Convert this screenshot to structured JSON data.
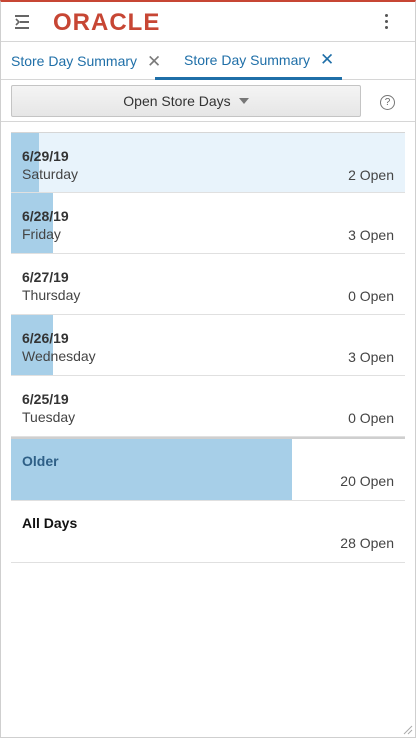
{
  "header": {
    "logo_text": "ORACLE",
    "brand_color": "#c74634"
  },
  "tabs": [
    {
      "label": "Store Day Summary",
      "active": false
    },
    {
      "label": "Store Day Summary",
      "active": true
    }
  ],
  "toolbar": {
    "dropdown_label": "Open Store Days",
    "help_label": "?"
  },
  "list": {
    "items": [
      {
        "date": "6/29/19",
        "day": "Saturday",
        "count": "2 Open",
        "open": 2,
        "selected": true
      },
      {
        "date": "6/28/19",
        "day": "Friday",
        "count": "3 Open",
        "open": 3,
        "selected": false
      },
      {
        "date": "6/27/19",
        "day": "Thursday",
        "count": "0 Open",
        "open": 0,
        "selected": false
      },
      {
        "date": "6/26/19",
        "day": "Wednesday",
        "count": "3 Open",
        "open": 3,
        "selected": false
      },
      {
        "date": "6/25/19",
        "day": "Tuesday",
        "count": "0 Open",
        "open": 0,
        "selected": false
      }
    ],
    "older": {
      "label": "Older",
      "count": "20 Open",
      "open": 20
    },
    "all_days": {
      "label": "All Days",
      "count": "28 Open",
      "open": 28
    }
  },
  "colors": {
    "bar": "#a7cfe8",
    "selected_row": "#e8f3fb",
    "link": "#1f6fa8"
  }
}
